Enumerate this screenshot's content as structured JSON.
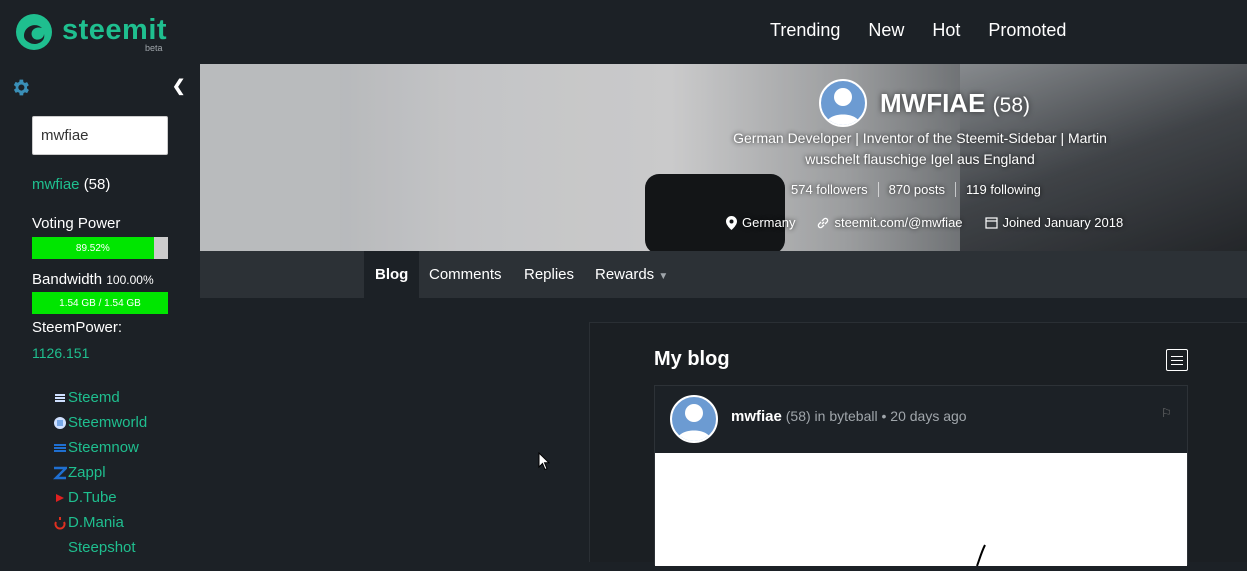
{
  "header": {
    "logo_text": "steemit",
    "logo_beta": "beta",
    "nav": [
      "Trending",
      "New",
      "Hot",
      "Promoted"
    ]
  },
  "sidebar": {
    "collapse_glyph": "❮",
    "search_value": "mwfiae",
    "user": "mwfiae",
    "user_rep": "(58)",
    "voting_label": "Voting Power",
    "voting_value": "89.52%",
    "voting_fraction": 0.8952,
    "bandwidth_label": "Bandwidth",
    "bandwidth_percent": "100.00%",
    "bandwidth_value": "1.54 GB / 1.54 GB",
    "bandwidth_fraction": 1.0,
    "steempower_label": "SteemPower:",
    "steempower_value": "1126.151",
    "links": [
      {
        "label": "Steemd",
        "icon": "steemd-icon",
        "color": "#e8f0ff"
      },
      {
        "label": "Steemworld",
        "icon": "steemworld-icon",
        "color": "#e8f0ff"
      },
      {
        "label": "Steemnow",
        "icon": "steemnow-icon",
        "color": "#1f6fd1"
      },
      {
        "label": "Zappl",
        "icon": "zappl-icon",
        "color": "#1f6fd1"
      },
      {
        "label": "D.Tube",
        "icon": "dtube-icon",
        "color": "#e02020"
      },
      {
        "label": "D.Mania",
        "icon": "dmania-icon",
        "color": "#e03020"
      },
      {
        "label": "Steepshot",
        "icon": "steepshot-icon",
        "color": "#1c2126"
      }
    ]
  },
  "profile": {
    "name": "MWFIAE",
    "rep": "(58)",
    "about": "German Developer | Inventor of the Steemit-Sidebar | Martin wuschelt flauschige Igel aus England",
    "followers": "574 followers",
    "posts": "870 posts",
    "following": "119 following",
    "location": "Germany",
    "website": "steemit.com/@mwfiae",
    "joined": "Joined January 2018"
  },
  "tabs": [
    {
      "label": "Blog",
      "active": true
    },
    {
      "label": "Comments",
      "active": false
    },
    {
      "label": "Replies",
      "active": false
    },
    {
      "label": "Rewards",
      "active": false
    }
  ],
  "main": {
    "title": "My blog",
    "post": {
      "author": "mwfiae",
      "rep": "(58)",
      "in": "in",
      "category": "byteball",
      "time": "• 20 days ago"
    }
  },
  "colors": {
    "accent": "#1fbf8f",
    "bar_fill": "#00e600",
    "bg": "#1c2126"
  }
}
